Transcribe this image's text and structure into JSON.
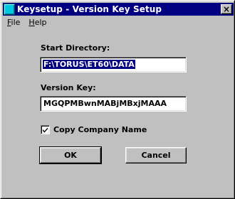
{
  "window": {
    "title": "Keysetup - Version Key Setup",
    "close_glyph": "×"
  },
  "menu": {
    "file": {
      "mnemonic": "F",
      "rest": "ile"
    },
    "help": {
      "mnemonic": "H",
      "rest": "elp"
    }
  },
  "form": {
    "start_directory": {
      "label": "Start Directory:",
      "value": "F:\\TORUS\\ET60\\DATA"
    },
    "version_key": {
      "label": "Version Key:",
      "value": "MGQPMBwnMABjMBxjMAAA"
    },
    "copy_company": {
      "label": "Copy Company Name",
      "checked": true
    }
  },
  "buttons": {
    "ok": "OK",
    "cancel": "Cancel"
  },
  "colors": {
    "titlebar": "#000080",
    "selection": "#000080",
    "face": "#c0c0c0",
    "app_icon": "#00c8e0"
  },
  "icons": {
    "app": "keysetup-app-icon",
    "close": "close-icon",
    "check": "checkmark-icon"
  }
}
